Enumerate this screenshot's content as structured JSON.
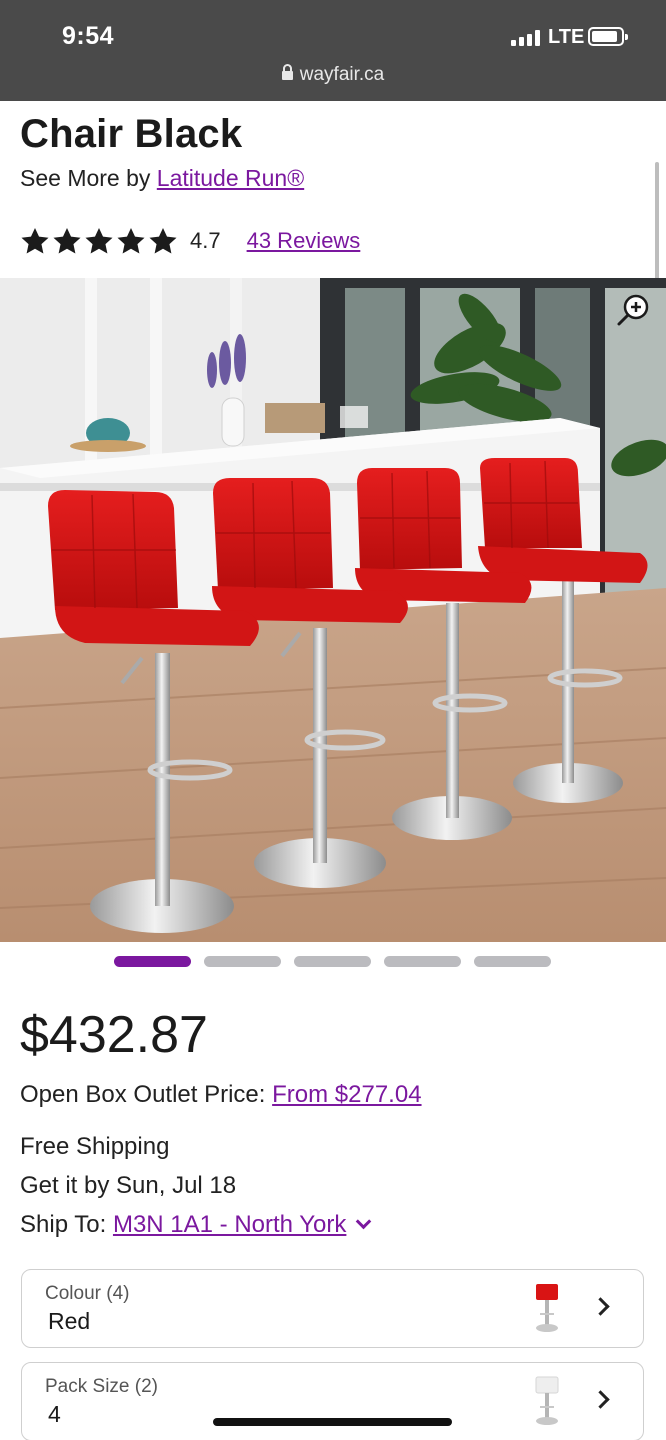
{
  "status_bar": {
    "time": "9:54",
    "network": "LTE"
  },
  "browser": {
    "url": "wayfair.ca"
  },
  "product": {
    "title": "Chair Black",
    "see_more_prefix": "See More by ",
    "brand": "Latitude Run®",
    "rating": "4.7",
    "stars": 5,
    "reviews_label": "43 Reviews"
  },
  "gallery": {
    "image_count": 5,
    "active_index": 0
  },
  "pricing": {
    "price": "$432.87",
    "open_box_label": "Open Box Outlet Price: ",
    "open_box_link": "From $277.04"
  },
  "shipping": {
    "free_shipping": "Free Shipping",
    "delivery": "Get it by Sun, Jul 18",
    "ship_to_label": "Ship To: ",
    "ship_to_value": "M3N 1A1 - North York"
  },
  "options": [
    {
      "label": "Colour (4)",
      "value": "Red",
      "thumb_color": "#d91414"
    },
    {
      "label": "Pack Size (2)",
      "value": "4",
      "thumb_color": "#eeeeee"
    }
  ],
  "colors": {
    "accent": "#7b189f",
    "stool": "#d91414",
    "topbar": "#4a4a4a"
  }
}
